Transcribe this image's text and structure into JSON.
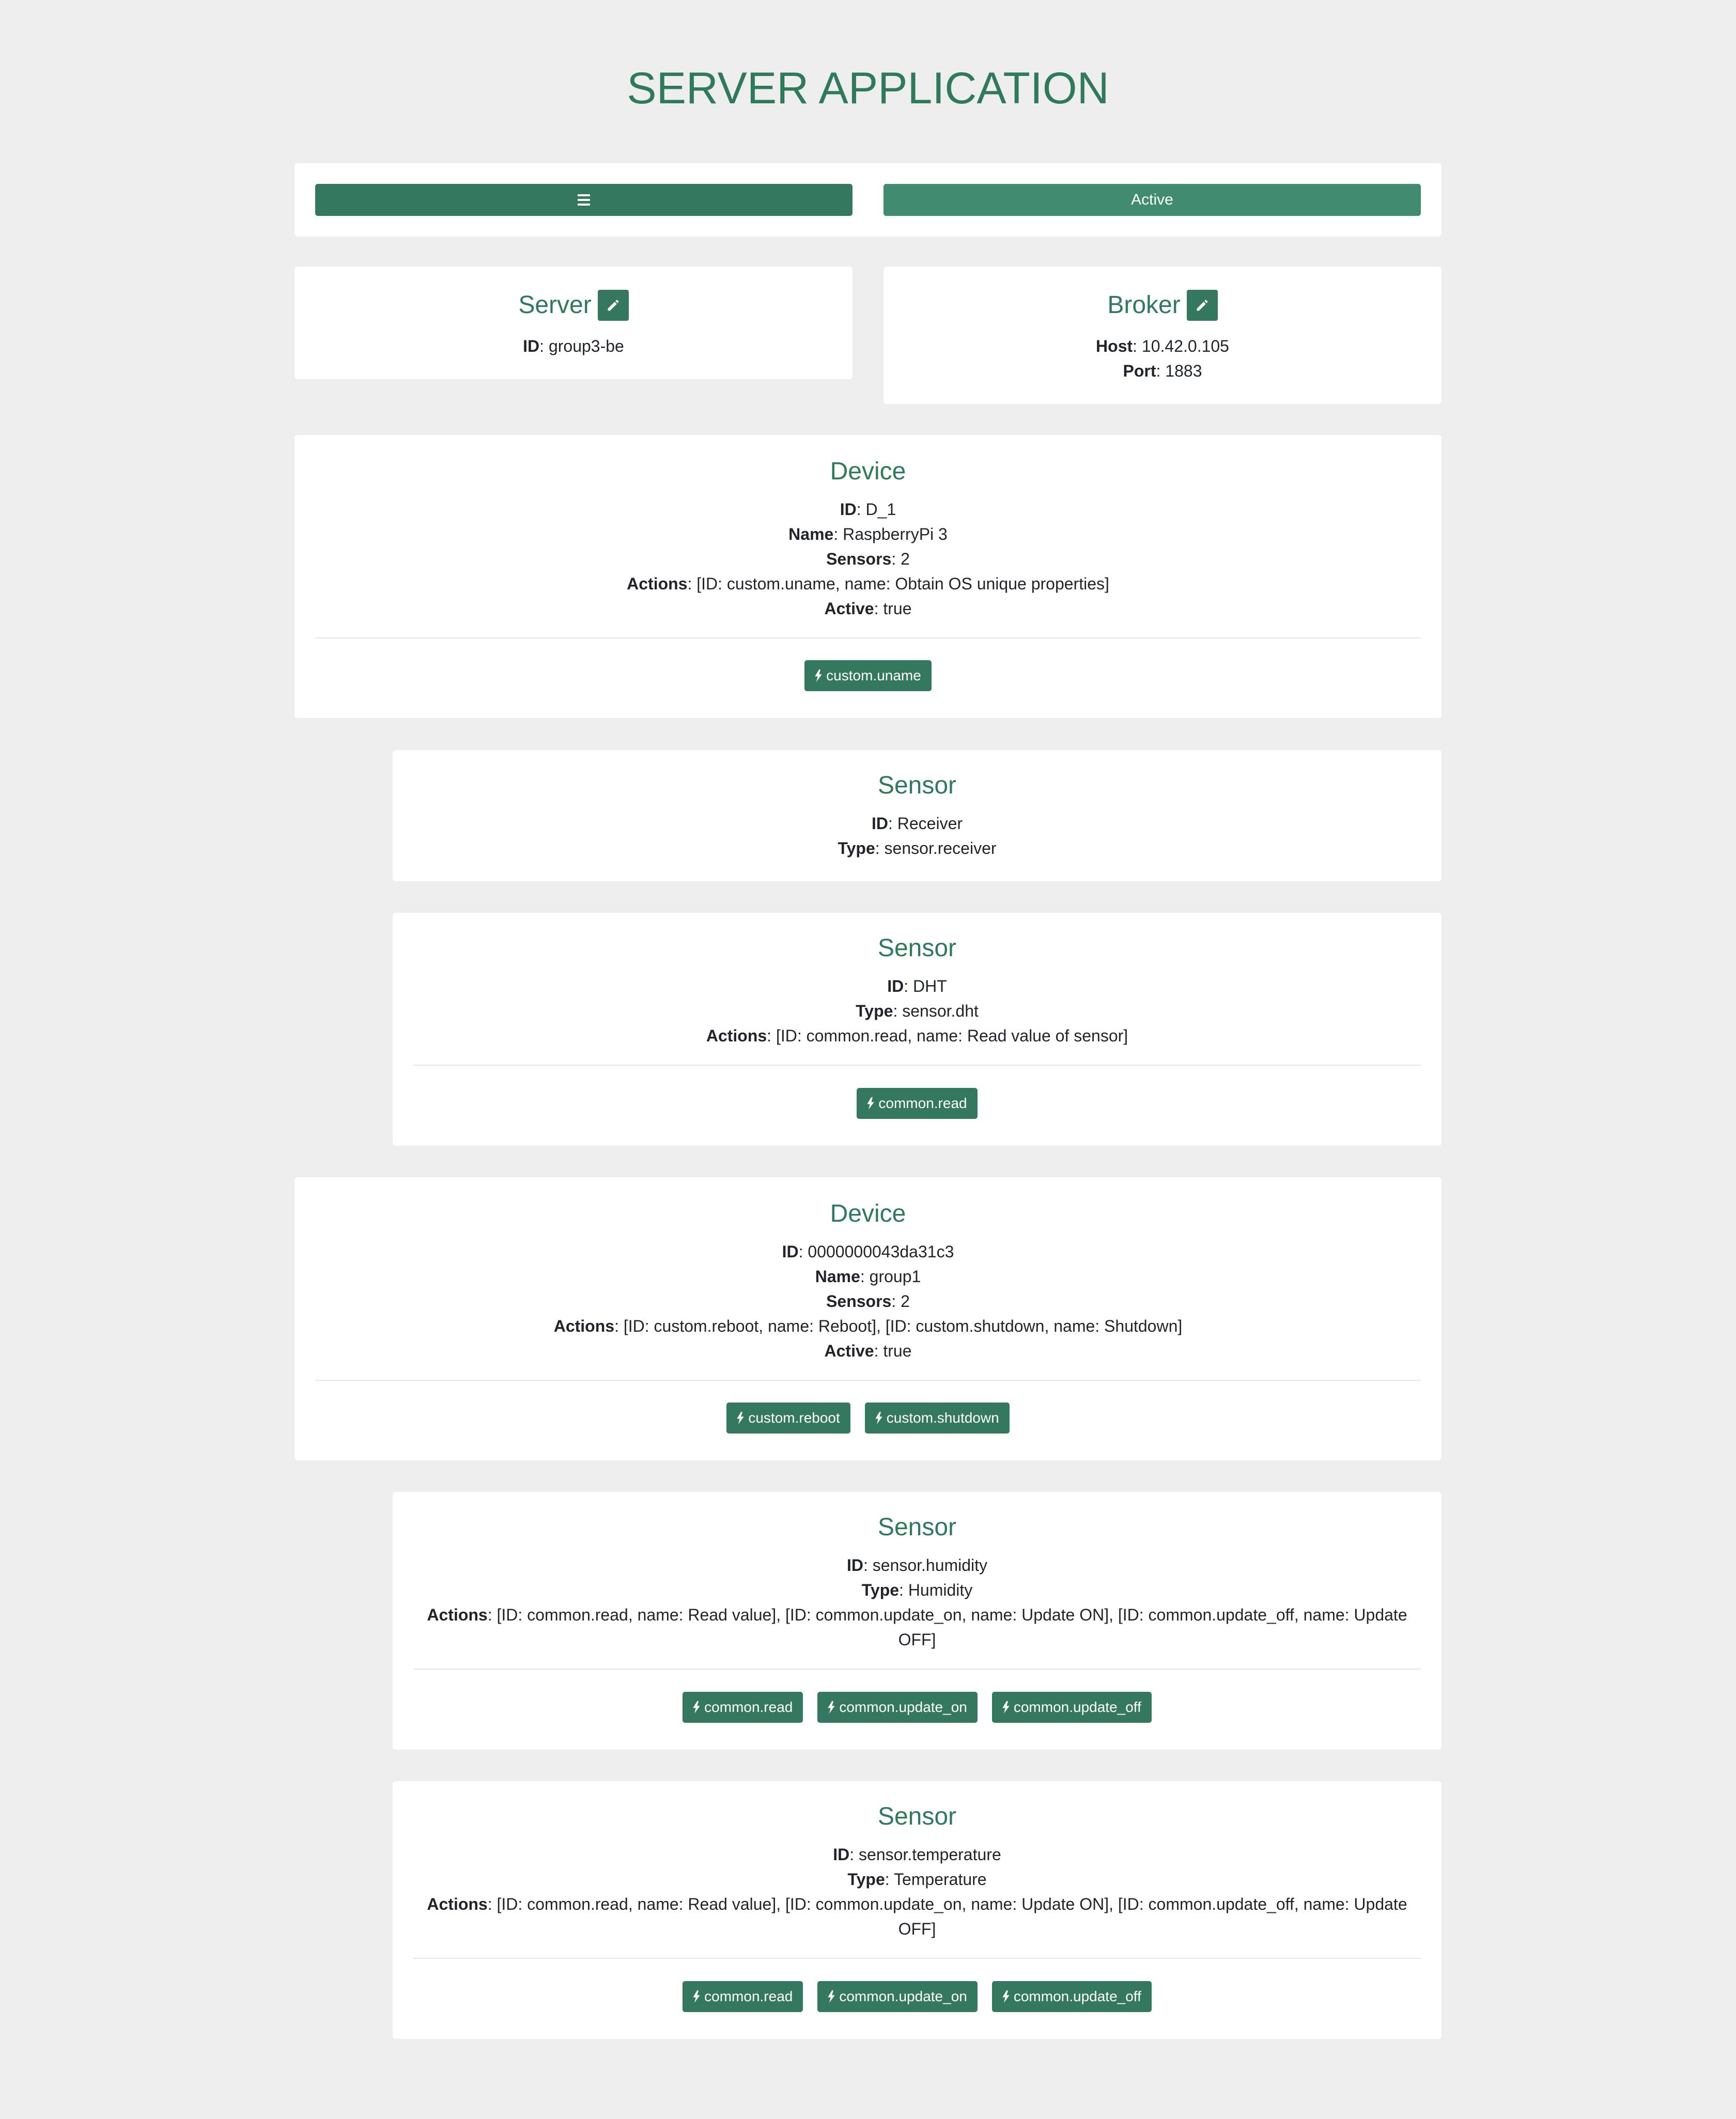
{
  "app": {
    "title": "SERVER APPLICATION"
  },
  "toolbar": {
    "menu_icon": "hamburger-icon",
    "status_label": "Active"
  },
  "colors": {
    "primary": "#357860",
    "title": "#2e7a5a",
    "background": "#eeeeee"
  },
  "server": {
    "title": "Server",
    "id_label": "ID",
    "id": "group3-be"
  },
  "broker": {
    "title": "Broker",
    "host_label": "Host",
    "host": "10.42.0.105",
    "port_label": "Port",
    "port": "1883"
  },
  "devices": [
    {
      "title": "Device",
      "id": "D_1",
      "name": "RaspberryPi 3",
      "sensors": "2",
      "actions_text": "[ID: custom.uname, name: Obtain OS unique properties]",
      "active": "true",
      "action_buttons": [
        "custom.uname"
      ],
      "sensor_cards": [
        {
          "title": "Sensor",
          "id": "Receiver",
          "type": "sensor.receiver"
        },
        {
          "title": "Sensor",
          "id": "DHT",
          "type": "sensor.dht",
          "actions_text": "[ID: common.read, name: Read value of sensor]",
          "action_buttons": [
            "common.read"
          ]
        }
      ]
    },
    {
      "title": "Device",
      "id": "0000000043da31c3",
      "name": "group1",
      "sensors": "2",
      "actions_text": "[ID: custom.reboot, name: Reboot], [ID: custom.shutdown, name: Shutdown]",
      "active": "true",
      "action_buttons": [
        "custom.reboot",
        "custom.shutdown"
      ],
      "sensor_cards": [
        {
          "title": "Sensor",
          "id": "sensor.humidity",
          "type": "Humidity",
          "actions_text_line1": "[ID: common.read, name: Read value], [ID: common.update_on, name: Update ON], [ID: common.update_off, name: Update",
          "actions_text_line2": "OFF]",
          "action_buttons": [
            "common.read",
            "common.update_on",
            "common.update_off"
          ]
        },
        {
          "title": "Sensor",
          "id": "sensor.temperature",
          "type": "Temperature",
          "actions_text_line1": "[ID: common.read, name: Read value], [ID: common.update_on, name: Update ON], [ID: common.update_off, name: Update",
          "actions_text_line2": "OFF]",
          "action_buttons": [
            "common.read",
            "common.update_on",
            "common.update_off"
          ]
        }
      ]
    }
  ],
  "labels": {
    "id": "ID",
    "name": "Name",
    "sensors": "Sensors",
    "actions": "Actions",
    "active": "Active",
    "type": "Type"
  }
}
